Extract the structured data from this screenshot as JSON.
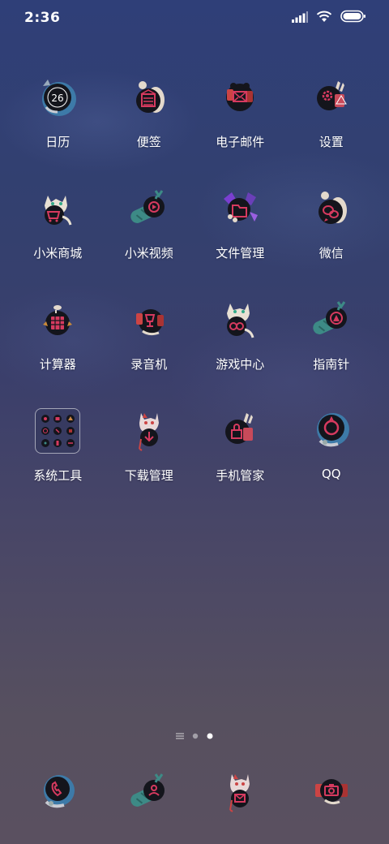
{
  "status_bar": {
    "time": "2:36",
    "icons": [
      "signal-icon",
      "wifi-icon",
      "battery-icon"
    ]
  },
  "apps": [
    {
      "label": "日历",
      "icon": "calendar-icon",
      "badge_text": "26"
    },
    {
      "label": "便签",
      "icon": "notes-icon"
    },
    {
      "label": "电子邮件",
      "icon": "email-icon"
    },
    {
      "label": "设置",
      "icon": "settings-icon"
    },
    {
      "label": "小米商城",
      "icon": "mi-store-icon"
    },
    {
      "label": "小米视频",
      "icon": "mi-video-icon"
    },
    {
      "label": "文件管理",
      "icon": "file-manager-icon"
    },
    {
      "label": "微信",
      "icon": "wechat-icon"
    },
    {
      "label": "计算器",
      "icon": "calculator-icon"
    },
    {
      "label": "录音机",
      "icon": "recorder-icon"
    },
    {
      "label": "游戏中心",
      "icon": "game-center-icon"
    },
    {
      "label": "指南针",
      "icon": "compass-icon"
    },
    {
      "label": "系统工具",
      "icon": "system-tools-folder-icon"
    },
    {
      "label": "下载管理",
      "icon": "downloads-icon"
    },
    {
      "label": "手机管家",
      "icon": "security-icon"
    },
    {
      "label": "QQ",
      "icon": "qq-icon"
    }
  ],
  "page_indicator": {
    "pages": 3,
    "current": 3
  },
  "dock": [
    {
      "icon": "phone-icon"
    },
    {
      "icon": "contacts-icon"
    },
    {
      "icon": "messages-icon"
    },
    {
      "icon": "camera-icon"
    }
  ],
  "colors": {
    "accent": "#d63a5f",
    "icon_bg": "#1a1a22",
    "teal": "#3d8a86",
    "purple": "#6a3fb8"
  }
}
